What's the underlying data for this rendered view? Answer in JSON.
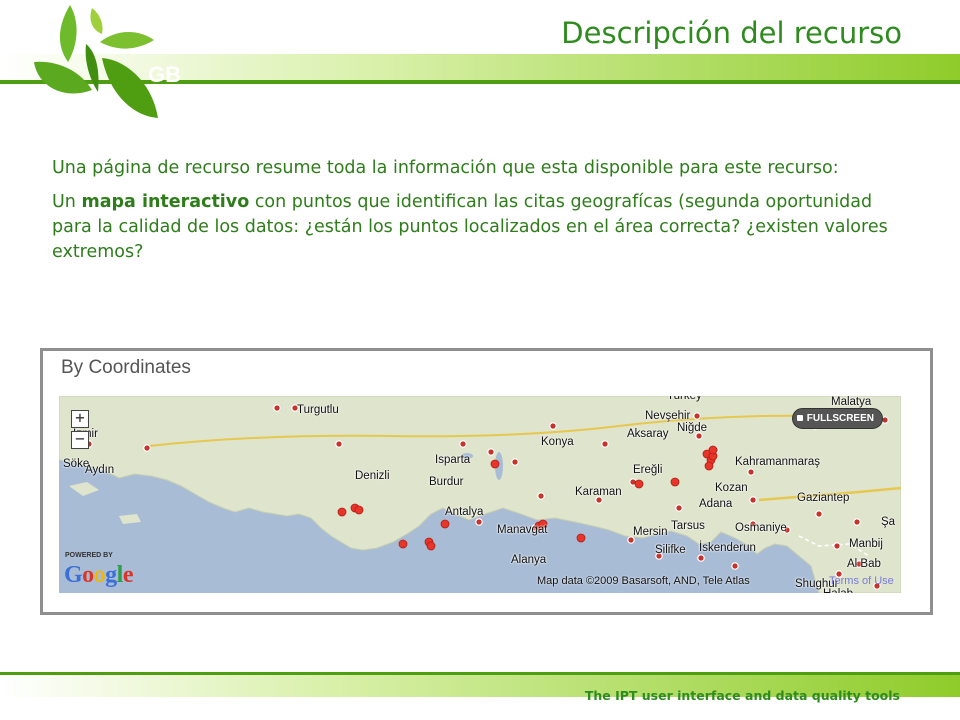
{
  "slide": {
    "title": "Descripción del recurso",
    "logo_text": "GBIF",
    "paragraph1": "Una página de recurso resume toda la información que esta disponible para este recurso:",
    "paragraph2_intro": "Un ",
    "paragraph2_bold": "mapa interactivo",
    "paragraph2_rest": " con puntos que identifican las citas geografícas (segunda oportunidad para la calidad de los datos: ¿están los puntos localizados en el área correcta? ¿existen valores extremos?",
    "footer": "The IPT user interface and data quality tools"
  },
  "map": {
    "heading": "By Coordinates",
    "fullscreen_label": "FULLSCREEN",
    "zoom_in_symbol": "+",
    "zoom_out_symbol": "−",
    "powered_by": "POWERED BY",
    "google_letters": [
      "G",
      "o",
      "o",
      "g",
      "l",
      "e"
    ],
    "google_colors": [
      "#3b6fd8",
      "#d9352a",
      "#f2b705",
      "#3b6fd8",
      "#2f9d4a",
      "#d9352a"
    ],
    "attribution": "Map data ©2009 Basarsoft, AND, Tele Atlas",
    "terms": "Terms of Use",
    "cities": [
      "Turkey",
      "Malatya",
      "Nevşehir",
      "Turgutlu",
      "İzmir",
      "Aksaray",
      "Konya",
      "Niğde",
      "Söke",
      "Aydın",
      "Denizli",
      "Isparta",
      "Burdur",
      "Ereğli",
      "Kahramanmaraş",
      "Kozan",
      "Karaman",
      "Adana",
      "Gaziantep",
      "Antalya",
      "Tarsus",
      "Osmaniye",
      "Şa",
      "Manavgat",
      "Mersin",
      "Silifke",
      "İskenderun",
      "Manbij",
      "Alanya",
      "Al Bab",
      "Shughur",
      "Halab"
    ],
    "colors": {
      "sea": "#a9bcd6",
      "land": "#dfe4cc",
      "marker_red": "#e8352a",
      "marker_gray": "#c9312a"
    }
  }
}
